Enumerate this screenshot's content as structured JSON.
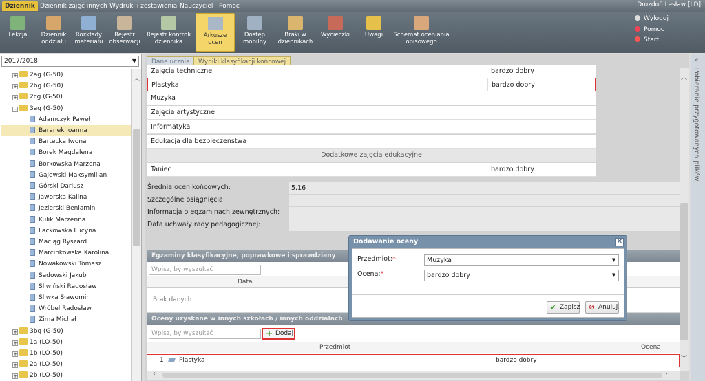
{
  "menu": {
    "items": [
      "Dziennik",
      "Dziennik zajęć innych",
      "Wydruki i zestawienia",
      "Nauczyciel",
      "Pomoc"
    ],
    "active": 0
  },
  "user": "Drozdoń Lesław [LD]",
  "toolbar": {
    "items": [
      {
        "label": "Lekcja",
        "icon": "lesson-icon"
      },
      {
        "label": "Dziennik\noddziału",
        "icon": "class-journal-icon"
      },
      {
        "label": "Rozkłady\nmateriału",
        "icon": "rm-icon"
      },
      {
        "label": "Rejestr\nobserwacji",
        "icon": "observation-icon"
      },
      {
        "label": "Rejestr kontroli\ndziennika",
        "icon": "control-register-icon"
      },
      {
        "label": "Arkusze\nocen",
        "icon": "grade-sheet-icon"
      },
      {
        "label": "Dostęp\nmobilny",
        "icon": "mobile-icon"
      },
      {
        "label": "Braki w\ndziennikach",
        "icon": "missing-icon"
      },
      {
        "label": "Wycieczki",
        "icon": "trip-icon"
      },
      {
        "label": "Uwagi",
        "icon": "notes-icon"
      },
      {
        "label": "Schemat oceniania\nopisowego",
        "icon": "scheme-icon"
      }
    ],
    "active": 5
  },
  "side_links": {
    "logout": "Wyloguj",
    "help": "Pomoc",
    "start": "Start"
  },
  "year": "2017/2018",
  "tree": {
    "classes_top": [
      "2ag (G-50)",
      "2bg (G-50)",
      "2cg (G-50)",
      "3ag (G-50)"
    ],
    "students": [
      "Adamczyk Paweł",
      "Baranek Joanna",
      "Bartecka Iwona",
      "Borek Magdalena",
      "Borkowska Marzena",
      "Gajewski Maksymilian",
      "Górski Dariusz",
      "Jaworska Kalina",
      "Jezierski Beniamin",
      "Kulik Marzenna",
      "Lackowska Lucyna",
      "Maciąg Ryszard",
      "Marcinkowska Karolina",
      "Nowakowski Tomasz",
      "Sadowski Jakub",
      "Śliwiński Radosław",
      "Śliwka Sławomir",
      "Wróbel Radosław",
      "Zima Michał"
    ],
    "selected_student": "Baranek Joanna",
    "classes_bottom": [
      "3bg (G-50)",
      "1a (LO-50)",
      "1b (LO-50)",
      "2a (LO-50)",
      "2b (LO-50)"
    ]
  },
  "tabs": [
    "Dane ucznia",
    "Wyniki klasyfikacji końcowej"
  ],
  "grades": [
    {
      "subject": "Zajęcia techniczne",
      "grade": "bardzo dobry"
    },
    {
      "subject": "Plastyka",
      "grade": "bardzo dobry"
    },
    {
      "subject": "Muzyka",
      "grade": ""
    },
    {
      "subject": "Zajęcia artystyczne",
      "grade": ""
    },
    {
      "subject": "Informatyka",
      "grade": ""
    },
    {
      "subject": "Edukacja dla bezpieczeństwa",
      "grade": ""
    }
  ],
  "extra_section": "Dodatkowe zajęcia edukacyjne",
  "extra_grades": [
    {
      "subject": "Taniec",
      "grade": "bardzo dobry"
    }
  ],
  "info": {
    "average_label": "Średnia ocen końcowych:",
    "average_value": "5.16",
    "achievements_label": "Szczególne osiągnięcia:",
    "exams_label": "Informacja o egzaminach zewnętrznych:",
    "resolution_label": "Data uchwały rady pedagogicznej:"
  },
  "exams_panel": {
    "title": "Egzaminy klasyfikacyjne, poprawkowe i sprawdziany",
    "search_placeholder": "Wpisz, by wyszukać",
    "col_date": "Data",
    "empty": "Brak danych"
  },
  "other_panel": {
    "title": "Oceny uzyskane w innych szkołach / innych oddziałach",
    "search_placeholder": "Wpisz, by wyszukać",
    "add_label": "Dodaj",
    "col_subject": "Przedmiot",
    "col_grade": "Ocena",
    "rows": [
      {
        "index": "1",
        "subject": "Plastyka",
        "grade": "bardzo dobry"
      }
    ]
  },
  "right_panel_label": "Pobieranie przygotowanych plików",
  "dialog": {
    "title": "Dodawanie oceny",
    "subject_label": "Przedmiot:",
    "subject_value": "Muzyka",
    "grade_label": "Ocena:",
    "grade_value": "bardzo dobry",
    "save": "Zapisz",
    "cancel": "Anuluj"
  },
  "colors": {
    "accent": "#e8c23a",
    "highlight": "#dd3333",
    "dialog": "#7891ab"
  }
}
